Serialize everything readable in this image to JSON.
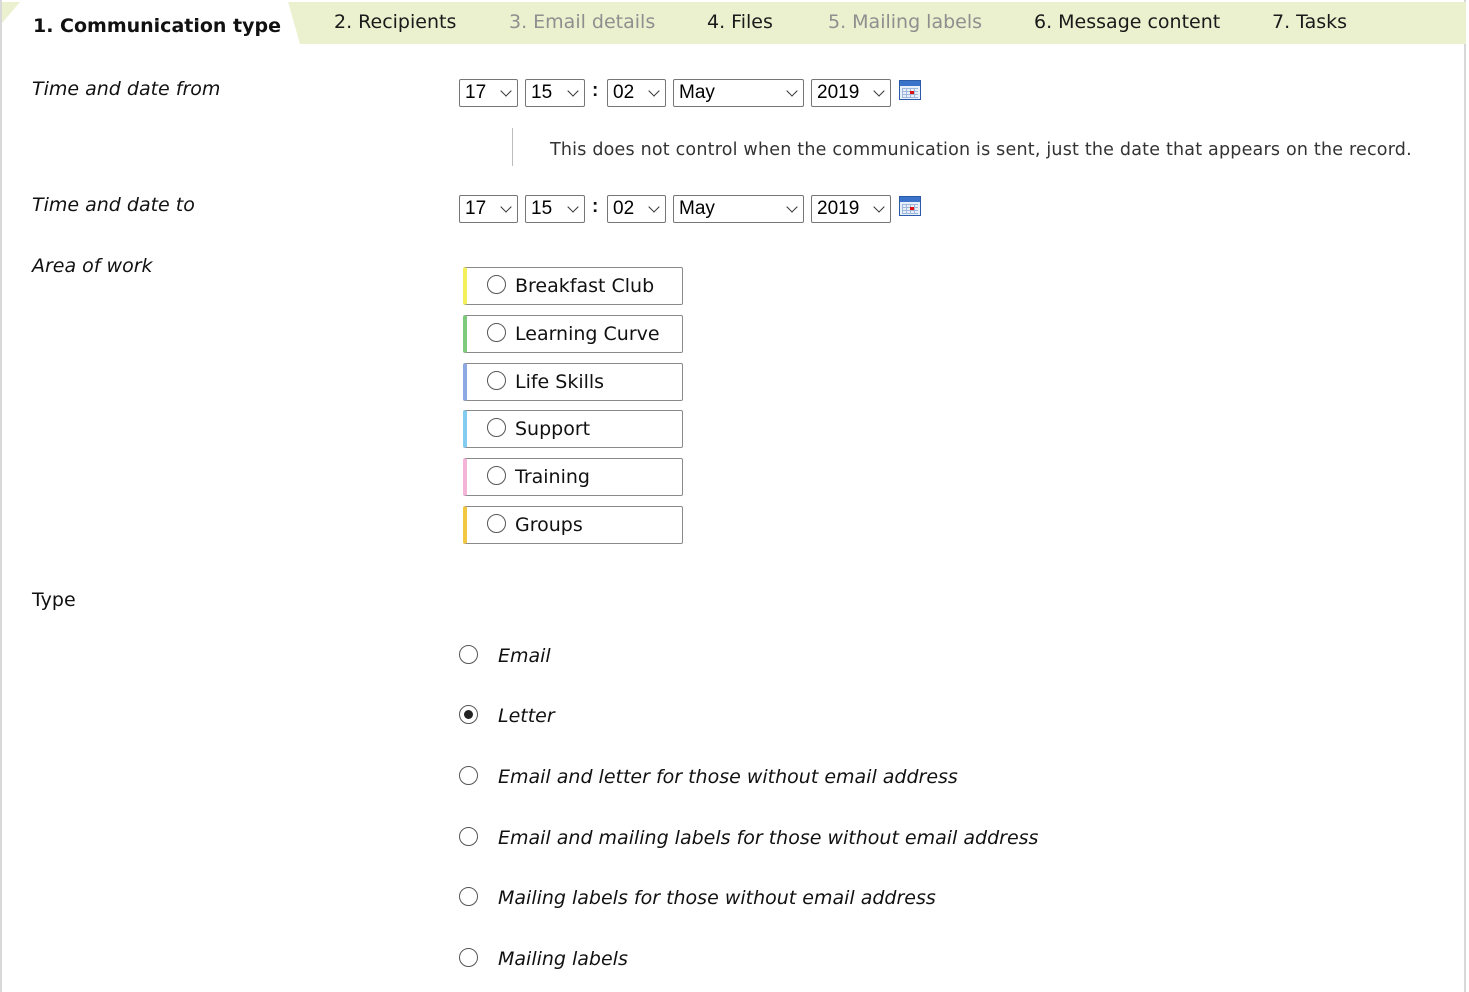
{
  "wizard": {
    "steps": [
      {
        "label": "1. Communication type",
        "state": "active"
      },
      {
        "label": "2. Recipients",
        "state": "enabled"
      },
      {
        "label": "3. Email details",
        "state": "disabled"
      },
      {
        "label": "4. Files",
        "state": "enabled"
      },
      {
        "label": "5. Mailing labels",
        "state": "disabled"
      },
      {
        "label": "6. Message content",
        "state": "enabled"
      },
      {
        "label": "7. Tasks",
        "state": "enabled"
      }
    ]
  },
  "from": {
    "label": "Time and date from",
    "hour": "17",
    "minute": "15",
    "second": "02",
    "month": "May",
    "year": "2019",
    "colon": ":",
    "calendar_icon": "calendar-icon"
  },
  "hint": "This does not control when the communication is sent, just the date that appears on the record.",
  "to": {
    "label": "Time and date to",
    "hour": "17",
    "minute": "15",
    "second": "02",
    "month": "May",
    "year": "2019",
    "colon": ":",
    "calendar_icon": "calendar-icon"
  },
  "area_of_work": {
    "label": "Area of work",
    "options": [
      {
        "label": "Breakfast Club",
        "color": "#f4ef5a",
        "selected": false
      },
      {
        "label": "Learning Curve",
        "color": "#7fcb7c",
        "selected": false
      },
      {
        "label": "Life Skills",
        "color": "#8ea8e3",
        "selected": false
      },
      {
        "label": "Support",
        "color": "#82cdf0",
        "selected": false
      },
      {
        "label": "Training",
        "color": "#f4b3d8",
        "selected": false
      },
      {
        "label": "Groups",
        "color": "#f2c842",
        "selected": false
      }
    ]
  },
  "type": {
    "label": "Type",
    "options": [
      {
        "label": "Email",
        "selected": false
      },
      {
        "label": "Letter",
        "selected": true
      },
      {
        "label": "Email and letter for those without email address",
        "selected": false
      },
      {
        "label": "Email and mailing labels for those without email address",
        "selected": false
      },
      {
        "label": "Mailing labels for those without email address",
        "selected": false
      },
      {
        "label": "Mailing labels",
        "selected": false
      }
    ]
  }
}
